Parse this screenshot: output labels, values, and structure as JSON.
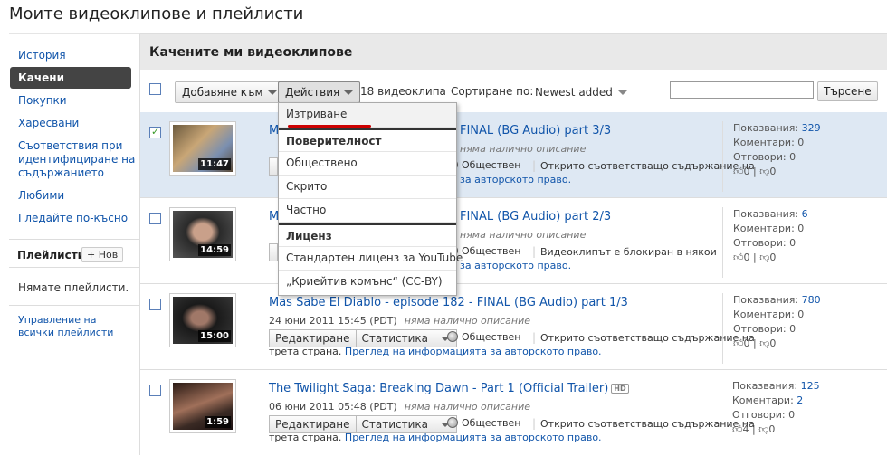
{
  "page_title": "Моите видеоклипове и плейлисти",
  "sidebar": {
    "items": [
      {
        "label": "История"
      },
      {
        "label": "Качени"
      },
      {
        "label": "Покупки"
      },
      {
        "label": "Харесвани"
      },
      {
        "label": "Съответствия при идентифициране на съдържанието"
      },
      {
        "label": "Любими"
      },
      {
        "label": "Гледайте по-късно"
      }
    ],
    "playlists_label": "Плейлисти",
    "new_button": "+ Нов",
    "no_playlists": "Нямате плейлисти.",
    "manage_link": "Управление на всички плейлисти"
  },
  "main": {
    "title": "Качените ми видеоклипове",
    "toolbar": {
      "add_to": "Добавяне към",
      "actions": "Действия",
      "count": "18 видеоклипа",
      "sort_label": "Сортиране по:",
      "sort_value": "Newest added",
      "search_button": "Търсене",
      "search_value": ""
    },
    "dropdown": {
      "delete": "Изтриване",
      "privacy_head": "Поверителност",
      "public": "Обществено",
      "hidden": "Скрито",
      "private": "Частно",
      "license_head": "Лиценз",
      "std_license": "Стандартен лиценз за YouTube",
      "cc_license": "„Криейтив комънс“ (CC-BY)"
    },
    "labels": {
      "edit": "Редактиране",
      "stats": "Статистика",
      "public": "Обществен",
      "views": "Показвания:",
      "comments": "Коментари:",
      "replies": "Отговори:",
      "no_desc": "няма налично описание",
      "review": "Преглед на информацията за авторското право."
    },
    "videos": [
      {
        "title": "Mas Sabe El Diablo - episode 182 - FINAL (BG Audio) part 3/3",
        "title_visible": "M",
        "title_tail": "FINAL (BG Audio) part 3/3",
        "date": "",
        "duration": "11:47",
        "note_a": "Открито съответстващо съдържание на",
        "note_b": "за авторското право.",
        "views": "329",
        "comments": "0",
        "replies": "0",
        "likes": "0",
        "dislikes": "0",
        "checked": true
      },
      {
        "title": "Mas Sabe El Diablo - episode 182 - FINAL (BG Audio) part 2/3",
        "title_visible": "M",
        "title_tail": "FINAL (BG Audio) part 2/3",
        "date": "",
        "duration": "14:59",
        "note_a": "Видеоклипът е блокиран в някои",
        "note_b": "за авторското право.",
        "views": "6",
        "comments": "0",
        "replies": "0",
        "likes": "0",
        "dislikes": "0",
        "checked": false
      },
      {
        "title": "Mas Sabe El Diablo - episode 182 - FINAL (BG Audio) part 1/3",
        "date": "24 юни 2011 15:45 (PDT)",
        "duration": "15:00",
        "note_a": "Открито съответстващо съдържание на",
        "note_b": "трета страна.",
        "views": "780",
        "comments": "0",
        "replies": "0",
        "likes": "0",
        "dislikes": "0",
        "checked": false
      },
      {
        "title": "The Twilight Saga: Breaking Dawn - Part 1 (Official Trailer)",
        "hd": "HD",
        "date": "06 юни 2011 05:48 (PDT)",
        "duration": "1:59",
        "note_a": "Открито съответстващо съдържание на",
        "note_b": "трета страна.",
        "views": "125",
        "comments": "2",
        "replies": "0",
        "likes": "4",
        "dislikes": "0",
        "checked": false
      }
    ]
  },
  "colors": {
    "accent": "#1155aa",
    "selected_row": "#dee8f3",
    "active_nav": "#444444",
    "underline": "#cc0000"
  }
}
